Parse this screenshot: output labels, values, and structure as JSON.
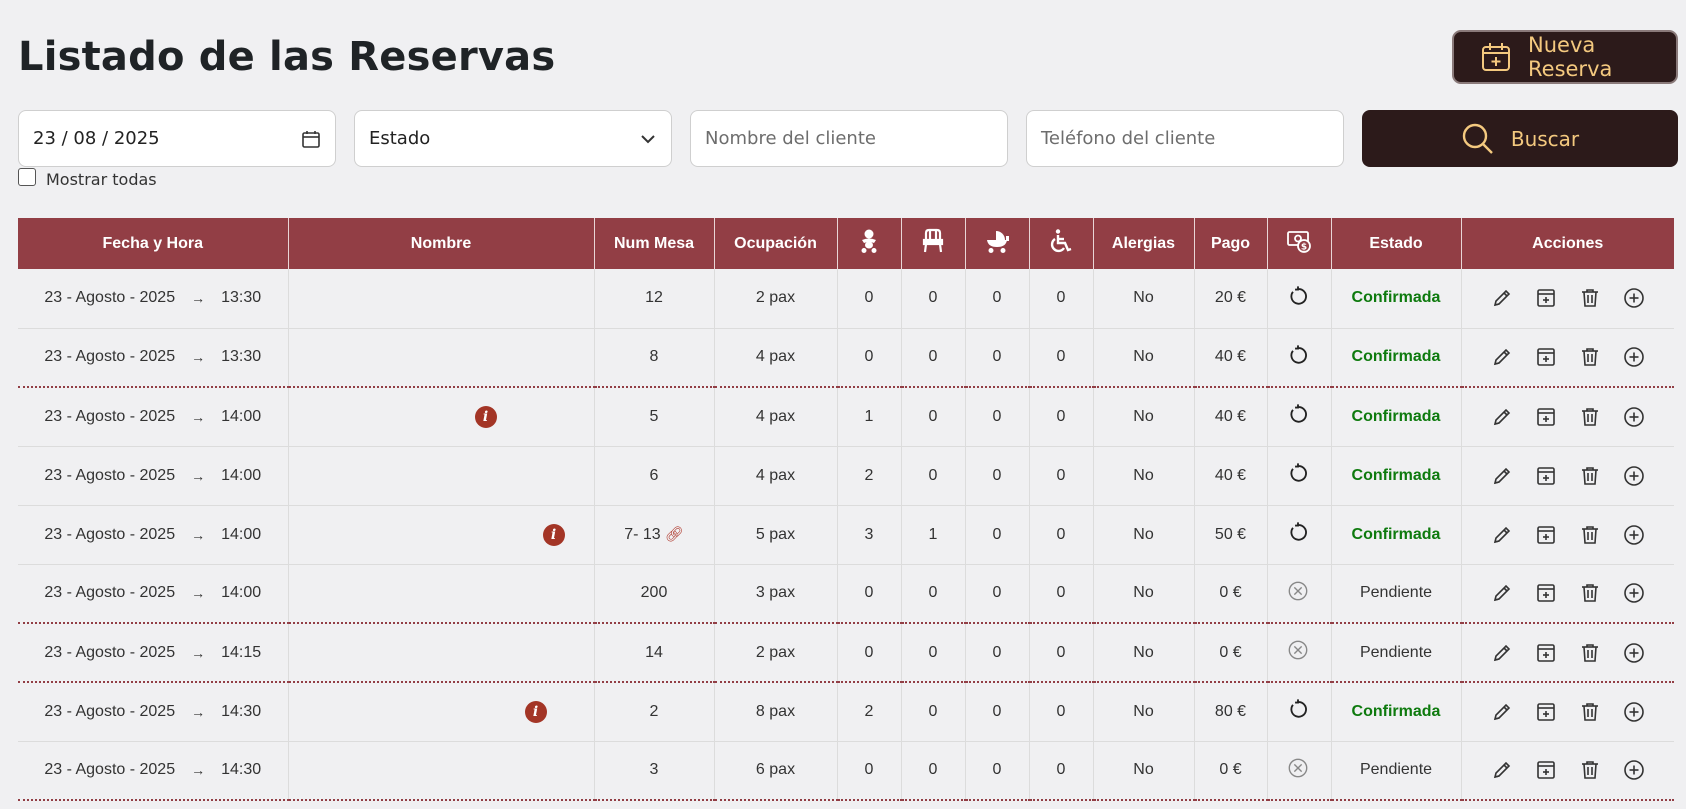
{
  "page": {
    "title": "Listado de las Reservas",
    "new_button_label": "Nueva Reserva"
  },
  "filters": {
    "date_value": "23 / 08 / 2025",
    "estado_value": "Estado",
    "nombre_placeholder": "Nombre del cliente",
    "telefono_placeholder": "Teléfono del cliente",
    "search_label": "Buscar",
    "show_all_label": "Mostrar todas"
  },
  "table": {
    "headers": {
      "fecha": "Fecha y Hora",
      "nombre": "Nombre",
      "mesa": "Num Mesa",
      "ocupacion": "Ocupación",
      "alergias": "Alergias",
      "pago": "Pago",
      "estado": "Estado",
      "acciones": "Acciones"
    },
    "header_icons": [
      "baby-icon",
      "high-chair-icon",
      "stroller-icon",
      "wheelchair-icon",
      "payment-status-icon"
    ],
    "rows": [
      {
        "date": "23 - Agosto - 2025",
        "arrow": "→",
        "time": "13:30",
        "info": false,
        "mesa": "12",
        "linked": false,
        "ocupacion": "2 pax",
        "ninos": "0",
        "tronas": "0",
        "carritos": "0",
        "movilidad": "0",
        "alergias": "No",
        "pago": "20 €",
        "paid": true,
        "estado": "Confirmada"
      },
      {
        "date": "23 - Agosto - 2025",
        "arrow": "→",
        "time": "13:30",
        "info": false,
        "mesa": "8",
        "linked": false,
        "ocupacion": "4 pax",
        "ninos": "0",
        "tronas": "0",
        "carritos": "0",
        "movilidad": "0",
        "alergias": "No",
        "pago": "40 €",
        "paid": true,
        "estado": "Confirmada"
      },
      {
        "date": "23 - Agosto - 2025",
        "arrow": "→",
        "time": "14:00",
        "info": true,
        "mesa": "5",
        "linked": false,
        "ocupacion": "4 pax",
        "ninos": "1",
        "tronas": "0",
        "carritos": "0",
        "movilidad": "0",
        "alergias": "No",
        "pago": "40 €",
        "paid": true,
        "estado": "Confirmada"
      },
      {
        "date": "23 - Agosto - 2025",
        "arrow": "→",
        "time": "14:00",
        "info": false,
        "mesa": "6",
        "linked": false,
        "ocupacion": "4 pax",
        "ninos": "2",
        "tronas": "0",
        "carritos": "0",
        "movilidad": "0",
        "alergias": "No",
        "pago": "40 €",
        "paid": true,
        "estado": "Confirmada"
      },
      {
        "date": "23 - Agosto - 2025",
        "arrow": "→",
        "time": "14:00",
        "info": true,
        "mesa": "7- 13",
        "linked": true,
        "ocupacion": "5 pax",
        "ninos": "3",
        "tronas": "1",
        "carritos": "0",
        "movilidad": "0",
        "alergias": "No",
        "pago": "50 €",
        "paid": true,
        "estado": "Confirmada"
      },
      {
        "date": "23 - Agosto - 2025",
        "arrow": "→",
        "time": "14:00",
        "info": false,
        "mesa": "200",
        "linked": false,
        "ocupacion": "3 pax",
        "ninos": "0",
        "tronas": "0",
        "carritos": "0",
        "movilidad": "0",
        "alergias": "No",
        "pago": "0 €",
        "paid": false,
        "estado": "Pendiente"
      },
      {
        "date": "23 - Agosto - 2025",
        "arrow": "→",
        "time": "14:15",
        "info": false,
        "mesa": "14",
        "linked": false,
        "ocupacion": "2 pax",
        "ninos": "0",
        "tronas": "0",
        "carritos": "0",
        "movilidad": "0",
        "alergias": "No",
        "pago": "0 €",
        "paid": false,
        "estado": "Pendiente"
      },
      {
        "date": "23 - Agosto - 2025",
        "arrow": "→",
        "time": "14:30",
        "info": true,
        "mesa": "2",
        "linked": false,
        "ocupacion": "8 pax",
        "ninos": "2",
        "tronas": "0",
        "carritos": "0",
        "movilidad": "0",
        "alergias": "No",
        "pago": "80 €",
        "paid": true,
        "estado": "Confirmada"
      },
      {
        "date": "23 - Agosto - 2025",
        "arrow": "→",
        "time": "14:30",
        "info": false,
        "mesa": "3",
        "linked": false,
        "ocupacion": "6 pax",
        "ninos": "0",
        "tronas": "0",
        "carritos": "0",
        "movilidad": "0",
        "alergias": "No",
        "pago": "0 €",
        "paid": false,
        "estado": "Pendiente"
      }
    ]
  },
  "colors": {
    "header_bg": "#923e45",
    "dark_button": "#2c1a1a",
    "button_text": "#f4c97f",
    "confirmed": "#0e7a0e",
    "info_badge": "#a33526"
  }
}
